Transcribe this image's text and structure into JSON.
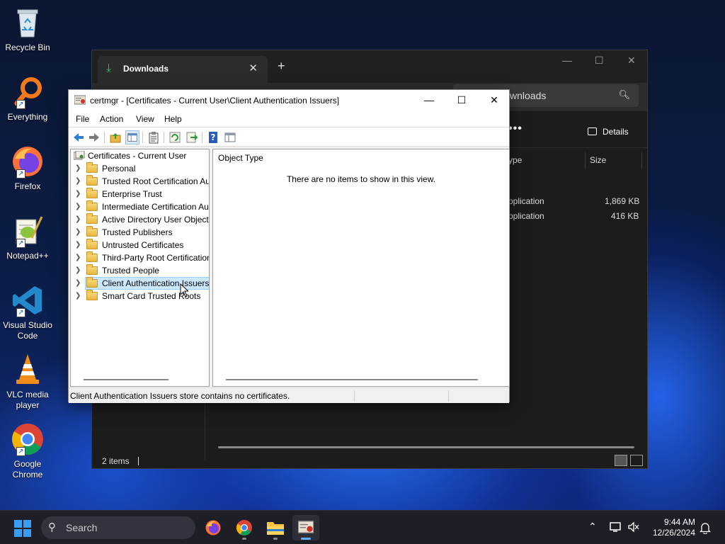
{
  "desktop": {
    "icons": [
      {
        "label": "Recycle Bin"
      },
      {
        "label": "Everything"
      },
      {
        "label": "Firefox"
      },
      {
        "label": "Notepad++"
      },
      {
        "label": "Visual Studio Code"
      },
      {
        "label": "VLC media player"
      },
      {
        "label": "Google Chrome"
      }
    ]
  },
  "explorer": {
    "tab_title": "Downloads",
    "search_placeholder": "wnloads",
    "more_label": "•••",
    "details_label": "Details",
    "columns": {
      "type": "ype",
      "size": "Size"
    },
    "rows": [
      {
        "type": "pplication",
        "size": "1,869 KB"
      },
      {
        "type": "pplication",
        "size": "416 KB"
      }
    ],
    "status": "2 items"
  },
  "certmgr": {
    "title": "certmgr - [Certificates - Current User\\Client Authentication Issuers]",
    "menu": [
      "File",
      "Action",
      "View",
      "Help"
    ],
    "tree_root": "Certificates - Current User",
    "tree_items": [
      "Personal",
      "Trusted Root Certification Au",
      "Enterprise Trust",
      "Intermediate Certification Au",
      "Active Directory User Object",
      "Trusted Publishers",
      "Untrusted Certificates",
      "Third-Party Root Certification",
      "Trusted People",
      "Client Authentication Issuers",
      "Smart Card Trusted Roots"
    ],
    "selected_item": "Client Authentication Issuers",
    "list_column": "Object Type",
    "empty_message": "There are no items to show in this view.",
    "status": "Client Authentication Issuers store contains no certificates."
  },
  "taskbar": {
    "search_label": "Search",
    "time": "9:44 AM",
    "date": "12/26/2024"
  }
}
